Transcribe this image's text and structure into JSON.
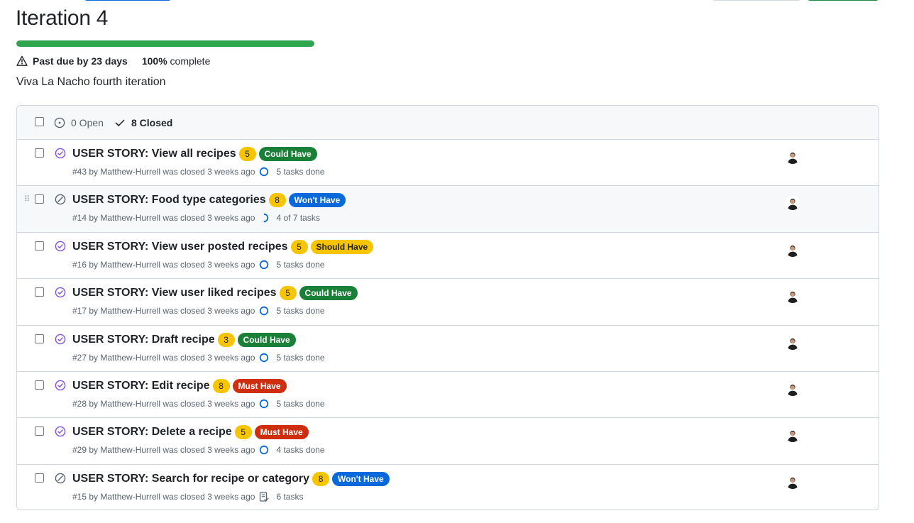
{
  "milestone": {
    "title": "Iteration 4",
    "progress_percent": 100,
    "past_due": "Past due by 23 days",
    "percent_label": "100%",
    "complete_label": "complete",
    "description": "Viva La Nacho fourth iteration"
  },
  "filters": {
    "open_label": "0 Open",
    "closed_label": "8 Closed"
  },
  "colors": {
    "progress": "#2da44e",
    "points_badge": "#f7c400",
    "closed_icon": "#8250df",
    "skipped_icon": "#59636e",
    "task_circle": "#0969da"
  },
  "issues": [
    {
      "title": "USER STORY: View all recipes",
      "points": "5",
      "label": "Could Have",
      "label_color": "#1a7f37",
      "meta": "#43 by Matthew-Hurrell was closed 3 weeks ago",
      "tasks": "5 tasks done",
      "state_icon": "check-circle-icon",
      "task_icon": "circle-icon"
    },
    {
      "title": "USER STORY: Food type categories",
      "points": "8",
      "label": "Won't Have",
      "label_color": "#0969da",
      "meta": "#14 by Matthew-Hurrell was closed 3 weeks ago",
      "tasks": "4 of 7 tasks",
      "state_icon": "skip-circle-icon",
      "task_icon": "partial-progress-icon"
    },
    {
      "title": "USER STORY: View user posted recipes",
      "points": "5",
      "label": "Should Have",
      "label_color": "#f7c400",
      "meta": "#16 by Matthew-Hurrell was closed 3 weeks ago",
      "tasks": "5 tasks done",
      "state_icon": "check-circle-icon",
      "task_icon": "circle-icon"
    },
    {
      "title": "USER STORY: View user liked recipes",
      "points": "5",
      "label": "Could Have",
      "label_color": "#1a7f37",
      "meta": "#17 by Matthew-Hurrell was closed 3 weeks ago",
      "tasks": "5 tasks done",
      "state_icon": "check-circle-icon",
      "task_icon": "circle-icon"
    },
    {
      "title": "USER STORY: Draft recipe",
      "points": "3",
      "label": "Could Have",
      "label_color": "#1a7f37",
      "meta": "#27 by Matthew-Hurrell was closed 3 weeks ago",
      "tasks": "5 tasks done",
      "state_icon": "check-circle-icon",
      "task_icon": "circle-icon"
    },
    {
      "title": "USER STORY: Edit recipe",
      "points": "8",
      "label": "Must Have",
      "label_color": "#cf2e0e",
      "meta": "#28 by Matthew-Hurrell was closed 3 weeks ago",
      "tasks": "5 tasks done",
      "state_icon": "check-circle-icon",
      "task_icon": "circle-icon"
    },
    {
      "title": "USER STORY: Delete a recipe",
      "points": "5",
      "label": "Must Have",
      "label_color": "#cf2e0e",
      "meta": "#29 by Matthew-Hurrell was closed 3 weeks ago",
      "tasks": "4 tasks done",
      "state_icon": "check-circle-icon",
      "task_icon": "circle-icon"
    },
    {
      "title": "USER STORY: Search for recipe or category",
      "points": "8",
      "label": "Won't Have",
      "label_color": "#0969da",
      "meta": "#15 by Matthew-Hurrell was closed 3 weeks ago",
      "tasks": "6 tasks",
      "state_icon": "skip-circle-icon",
      "task_icon": "tasklist-icon"
    }
  ]
}
